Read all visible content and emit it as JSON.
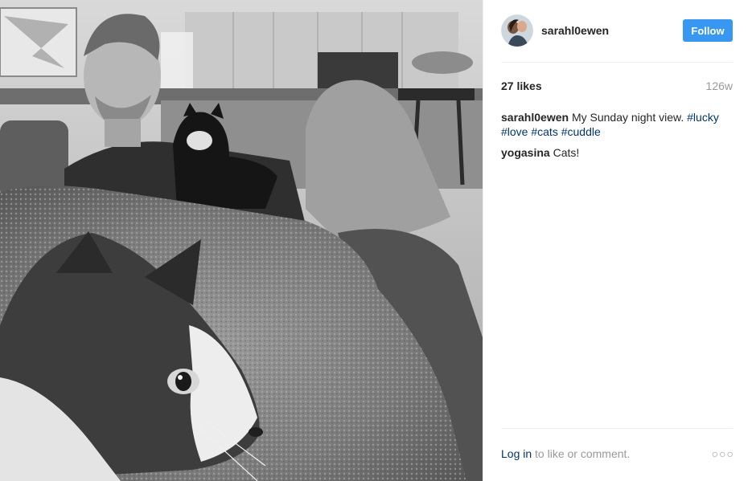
{
  "header": {
    "username": "sarahl0ewen",
    "follow_label": "Follow",
    "avatar_icon": "profile-photo"
  },
  "stats": {
    "likes": "27 likes",
    "age": "126w"
  },
  "comments": [
    {
      "user": "sarahl0ewen",
      "text": "My Sunday night view.",
      "hashtags": [
        "#lucky",
        "#love",
        "#cats",
        "#cuddle"
      ]
    },
    {
      "user": "yogasina",
      "text": "Cats!"
    }
  ],
  "footer": {
    "login_label": "Log in",
    "prompt_text": "to like or comment.",
    "more_icon": "more-options-icon"
  },
  "colors": {
    "follow_button": "#3897f0",
    "link": "#003569",
    "muted": "#999999",
    "text": "#262626"
  }
}
